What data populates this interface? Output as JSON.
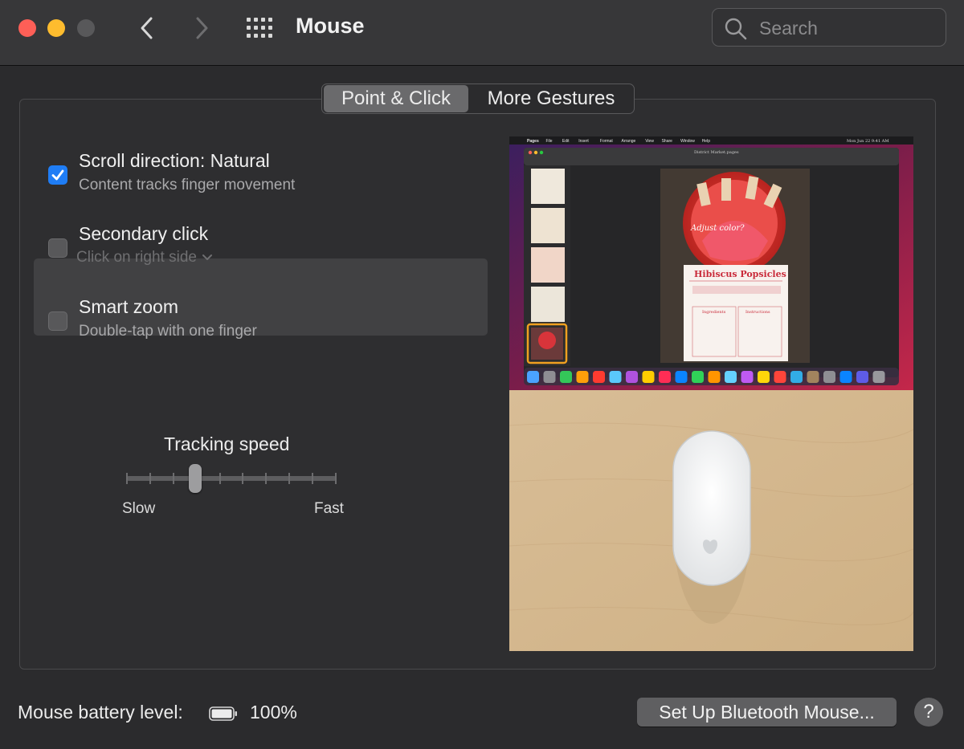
{
  "window": {
    "title": "Mouse",
    "search_placeholder": "Search"
  },
  "tabs": [
    {
      "label": "Point & Click",
      "active": true
    },
    {
      "label": "More Gestures",
      "active": false
    }
  ],
  "options": [
    {
      "title": "Scroll direction: Natural",
      "subtitle": "Content tracks finger movement",
      "checked": true
    },
    {
      "title": "Secondary click",
      "subtitle": "Click on right side",
      "checked": false
    },
    {
      "title": "Smart zoom",
      "subtitle": "Double-tap with one finger",
      "checked": false
    }
  ],
  "tracking": {
    "label": "Tracking speed",
    "min_label": "Slow",
    "max_label": "Fast",
    "ticks": 10,
    "value_fraction": 0.33
  },
  "preview": {
    "menu_items": [
      "Pages",
      "File",
      "Edit",
      "Insert",
      "Format",
      "Arrange",
      "View",
      "Share",
      "Window",
      "Help"
    ],
    "clock": "Mon Jun 22  9:41 AM",
    "doc_title": "District Market.pages",
    "recipe_title": "Hibiscus Popsicles",
    "handwriting": "Adjust color?",
    "ingredients_header": "Ingredients",
    "instructions_header": "Instructions"
  },
  "footer": {
    "battery_label": "Mouse battery level:",
    "battery_value": "100%",
    "battery_level": 1.0,
    "setup_button": "Set Up Bluetooth Mouse...",
    "help_button": "?"
  },
  "colors": {
    "accent": "#1f7df5",
    "close": "#fe5f57",
    "minimize": "#febc2e"
  }
}
